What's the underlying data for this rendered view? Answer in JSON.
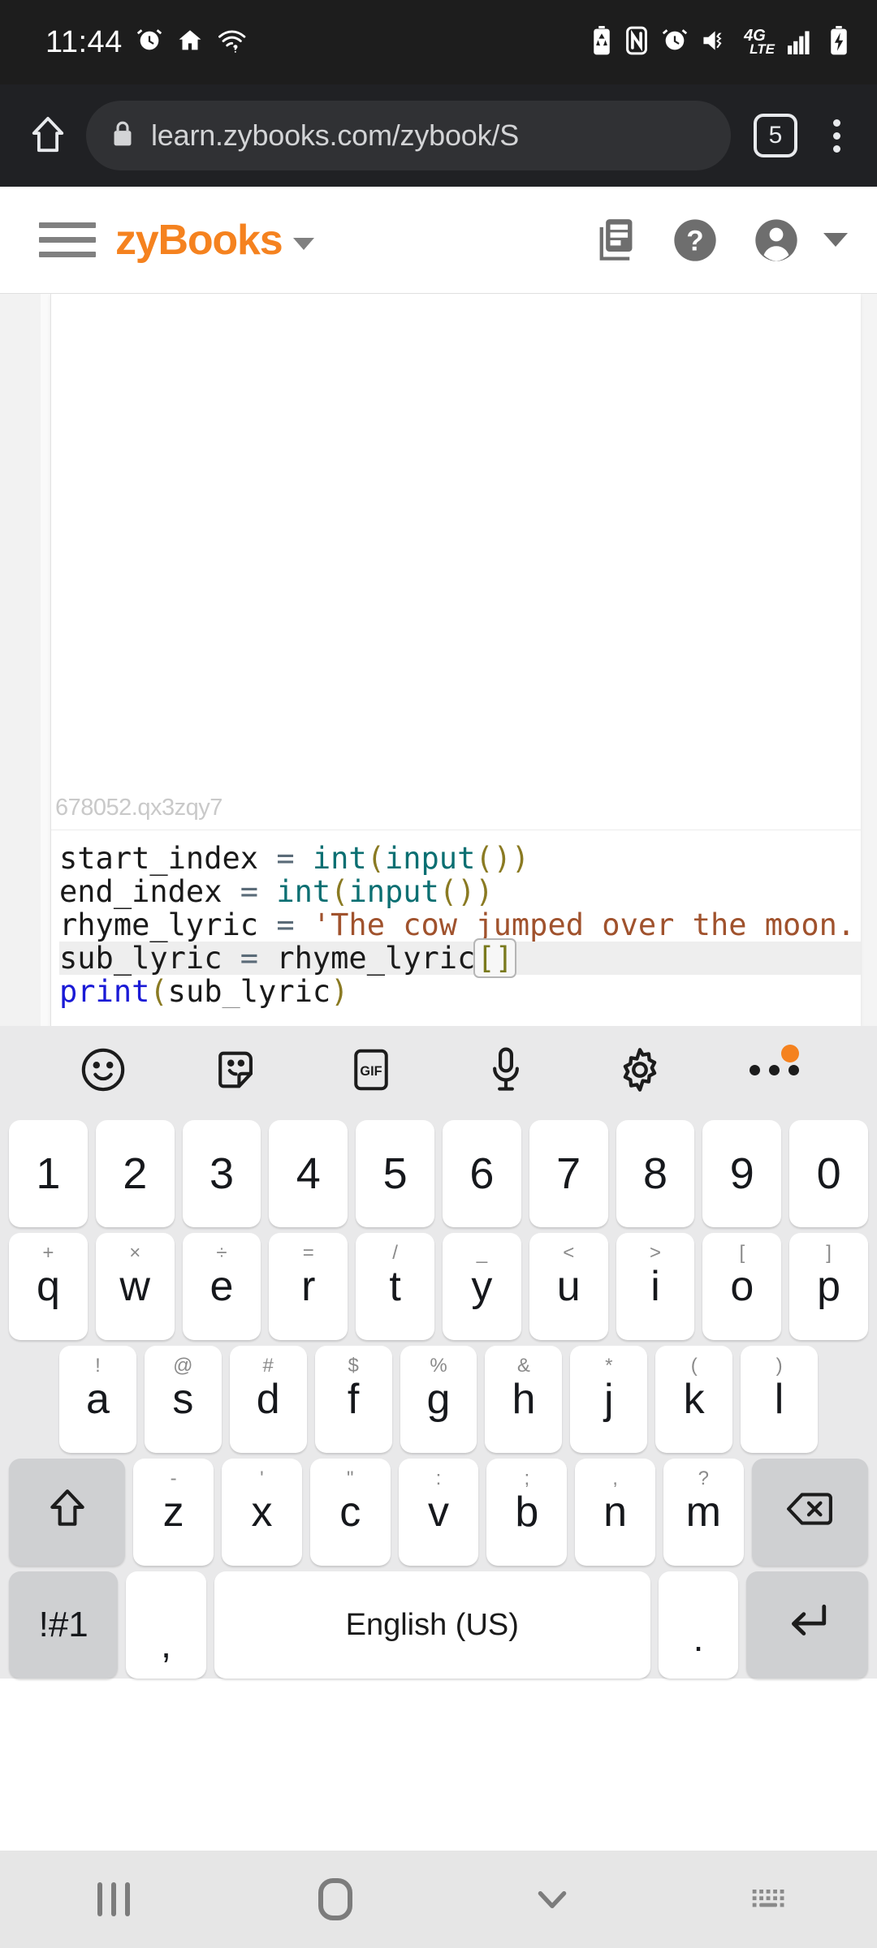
{
  "statusbar": {
    "time": "11:44",
    "left_icons": [
      "alarm-icon",
      "home-smart-icon",
      "wifi-question-icon"
    ],
    "right_icons": [
      "battery-saver-icon",
      "nfc-icon",
      "alarm-icon",
      "mute-vibrate-icon",
      "4g-lte-icon",
      "signal-bars-icon",
      "battery-charging-icon"
    ],
    "network_label": "4G",
    "network_sub": "LTE"
  },
  "browser": {
    "url": "learn.zybooks.com/zybook/S",
    "tab_count": "5",
    "lock_icon": "lock-icon",
    "home_icon": "home-icon",
    "menu_icon": "overflow-menu-icon"
  },
  "app_header": {
    "brand": "zyBooks",
    "menu_icon": "hamburger-menu-icon",
    "brand_caret": "chevron-down-icon",
    "catalog_icon": "library-books-icon",
    "help_icon": "help-circle-icon",
    "account_icon": "account-circle-icon",
    "account_caret": "chevron-down-icon"
  },
  "content": {
    "watermark": "678052.qx3zqy7",
    "code_lines": [
      [
        {
          "t": "start_index ",
          "c": "plain"
        },
        {
          "t": "=",
          "c": "op"
        },
        {
          "t": " ",
          "c": "plain"
        },
        {
          "t": "int",
          "c": "fn"
        },
        {
          "t": "(",
          "c": "par"
        },
        {
          "t": "input",
          "c": "fn"
        },
        {
          "t": "(",
          "c": "par"
        },
        {
          "t": "))",
          "c": "par"
        }
      ],
      [
        {
          "t": "end_index ",
          "c": "plain"
        },
        {
          "t": "=",
          "c": "op"
        },
        {
          "t": " ",
          "c": "plain"
        },
        {
          "t": "int",
          "c": "fn"
        },
        {
          "t": "(",
          "c": "par"
        },
        {
          "t": "input",
          "c": "fn"
        },
        {
          "t": "(",
          "c": "par"
        },
        {
          "t": "))",
          "c": "par"
        }
      ],
      [
        {
          "t": "rhyme_lyric ",
          "c": "plain"
        },
        {
          "t": "=",
          "c": "op"
        },
        {
          "t": " ",
          "c": "plain"
        },
        {
          "t": "'The cow jumped over the moon.",
          "c": "str"
        }
      ],
      [
        {
          "t": "sub_lyric ",
          "c": "plain"
        },
        {
          "t": "=",
          "c": "op"
        },
        {
          "t": " rhyme_lyric",
          "c": "plain"
        },
        {
          "t": "[]",
          "c": "brk"
        }
      ],
      [
        {
          "t": "print",
          "c": "kw"
        },
        {
          "t": "(",
          "c": "par"
        },
        {
          "t": "sub_lyric",
          "c": "plain"
        },
        {
          "t": ")",
          "c": "par"
        }
      ]
    ],
    "highlighted_line_index": 3
  },
  "keyboard": {
    "toolbar": [
      {
        "name": "emoji-icon",
        "label": "emoji"
      },
      {
        "name": "sticker-icon",
        "label": "sticker"
      },
      {
        "name": "gif-icon",
        "label": "GIF"
      },
      {
        "name": "microphone-icon",
        "label": "voice input"
      },
      {
        "name": "settings-gear-icon",
        "label": "settings"
      },
      {
        "name": "more-options-icon",
        "label": "more"
      }
    ],
    "rows": [
      [
        {
          "main": "1"
        },
        {
          "main": "2"
        },
        {
          "main": "3"
        },
        {
          "main": "4"
        },
        {
          "main": "5"
        },
        {
          "main": "6"
        },
        {
          "main": "7"
        },
        {
          "main": "8"
        },
        {
          "main": "9"
        },
        {
          "main": "0"
        }
      ],
      [
        {
          "main": "q",
          "sup": "+"
        },
        {
          "main": "w",
          "sup": "×"
        },
        {
          "main": "e",
          "sup": "÷"
        },
        {
          "main": "r",
          "sup": "="
        },
        {
          "main": "t",
          "sup": "/"
        },
        {
          "main": "y",
          "sup": "_"
        },
        {
          "main": "u",
          "sup": "<"
        },
        {
          "main": "i",
          "sup": ">"
        },
        {
          "main": "o",
          "sup": "["
        },
        {
          "main": "p",
          "sup": "]"
        }
      ],
      [
        {
          "main": "a",
          "sup": "!"
        },
        {
          "main": "s",
          "sup": "@"
        },
        {
          "main": "d",
          "sup": "#"
        },
        {
          "main": "f",
          "sup": "$"
        },
        {
          "main": "g",
          "sup": "%"
        },
        {
          "main": "h",
          "sup": "&"
        },
        {
          "main": "j",
          "sup": "*"
        },
        {
          "main": "k",
          "sup": "("
        },
        {
          "main": "l",
          "sup": ")"
        }
      ],
      [
        {
          "main": "z",
          "sup": "-"
        },
        {
          "main": "x",
          "sup": "'"
        },
        {
          "main": "c",
          "sup": "\""
        },
        {
          "main": "v",
          "sup": ":"
        },
        {
          "main": "b",
          "sup": ";"
        },
        {
          "main": "n",
          "sup": ","
        },
        {
          "main": "m",
          "sup": "?"
        }
      ]
    ],
    "shift_label": "shift-key",
    "backspace_label": "backspace-key",
    "symbols_label": "!#1",
    "comma_label": ",",
    "space_label": "English (US)",
    "period_label": ".",
    "enter_label": "enter-key"
  },
  "navbar": {
    "recents": "recent-apps-icon",
    "home": "home-nav-icon",
    "hide_keyboard": "chevron-down-icon",
    "keyboard_switch": "keyboard-switch-icon"
  }
}
